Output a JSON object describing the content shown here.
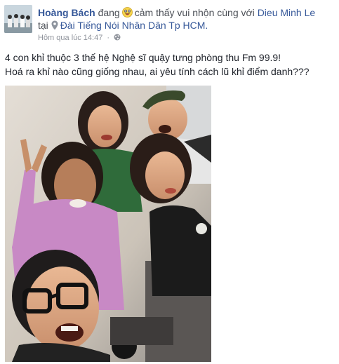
{
  "post": {
    "author_name": "Hoàng Bách",
    "feeling_prefix": "đang",
    "feeling_text": "cảm thấy vui nhộn cùng với",
    "tagged_friend": "Dieu Minh Le",
    "at_word": "tại",
    "location": "Đài Tiếng Nói Nhân Dân Tp HCM.",
    "timestamp": "Hôm qua lúc 14:47",
    "separator": "·",
    "caption_line1": "4 con khỉ thuộc 3 thế hệ Nghệ sĩ quậy tưng phòng thu Fm 99.9!",
    "caption_line2": "Hoá ra khỉ nào cũng giống nhau, ai yêu tính cách lũ khỉ điểm danh???"
  },
  "icons": {
    "feeling": "grinning-tongue-emoji-icon",
    "location": "map-pin-icon",
    "privacy": "globe-icon"
  },
  "colors": {
    "link": "#365899",
    "text": "#1d2129",
    "secondary": "#4b4f56",
    "meta": "#90949c"
  }
}
